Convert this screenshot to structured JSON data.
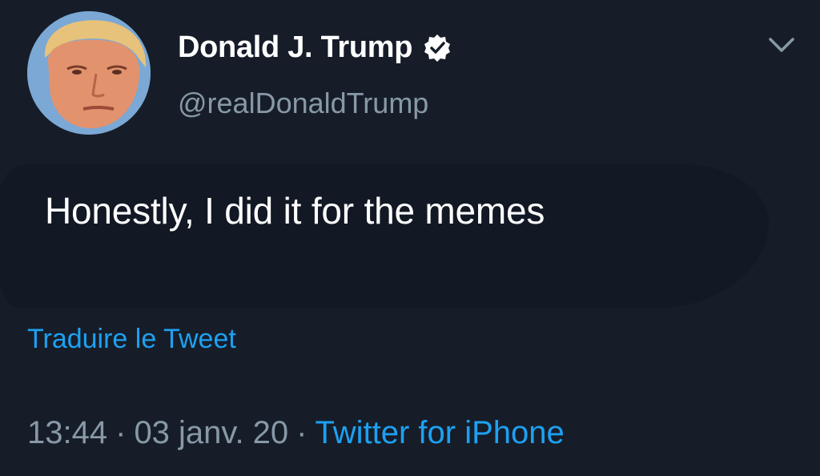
{
  "author": {
    "display_name": "Donald J. Trump",
    "handle": "@realDonaldTrump",
    "verified": true
  },
  "tweet": {
    "text": "Honestly, I did it for the memes",
    "translate_label": "Traduire le Tweet",
    "time": "13:44",
    "date": "03 janv. 20",
    "separator": "·",
    "source": "Twitter for iPhone"
  },
  "icons": {
    "avatar": "profile-photo",
    "verified": "verified-badge-icon",
    "menu": "chevron-down-icon"
  },
  "colors": {
    "background": "#161d29",
    "link": "#1da1f2",
    "secondary_text": "#8899a6",
    "primary_text": "#ffffff"
  }
}
